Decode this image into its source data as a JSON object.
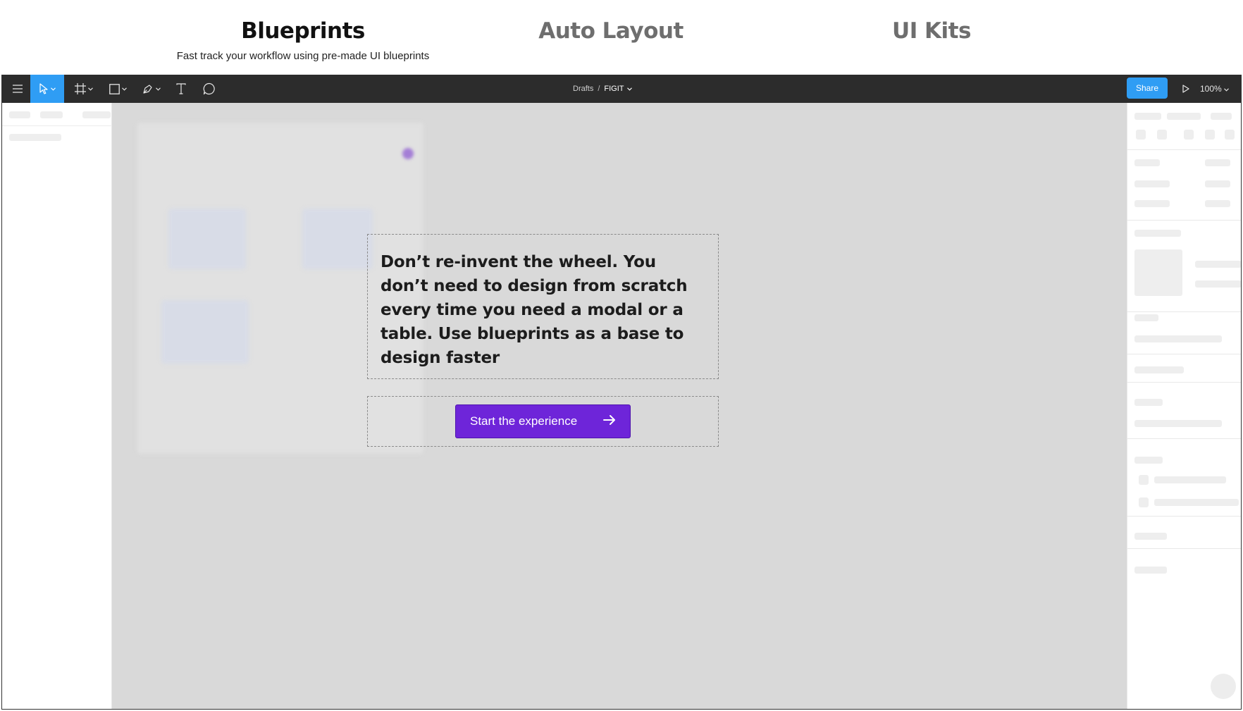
{
  "feature_tabs": [
    {
      "title": "Blueprints",
      "subtitle": "Fast track your workflow using pre-made UI blueprints",
      "active": true
    },
    {
      "title": "Auto Layout",
      "active": false
    },
    {
      "title": "UI Kits",
      "active": false
    }
  ],
  "toolbar": {
    "icons": [
      "menu-icon",
      "move-icon",
      "frame-icon",
      "rectangle-icon",
      "pen-icon",
      "text-icon",
      "comment-icon"
    ],
    "breadcrumb": {
      "folder": "Drafts",
      "separator": "/",
      "file": "FIGIT"
    },
    "share_label": "Share",
    "zoom": "100%"
  },
  "overlay": {
    "message": "Don’t re-invent the wheel. You don’t need to design from scratch every time you need a modal or a table. Use blueprints as a base to design faster",
    "cta_label": "Start the experience"
  },
  "colors": {
    "toolbar_bg": "#2c2c2c",
    "accent_blue": "#2f9df4",
    "cta_purple": "#6e25d9",
    "canvas_bg": "#d9d9d9"
  }
}
